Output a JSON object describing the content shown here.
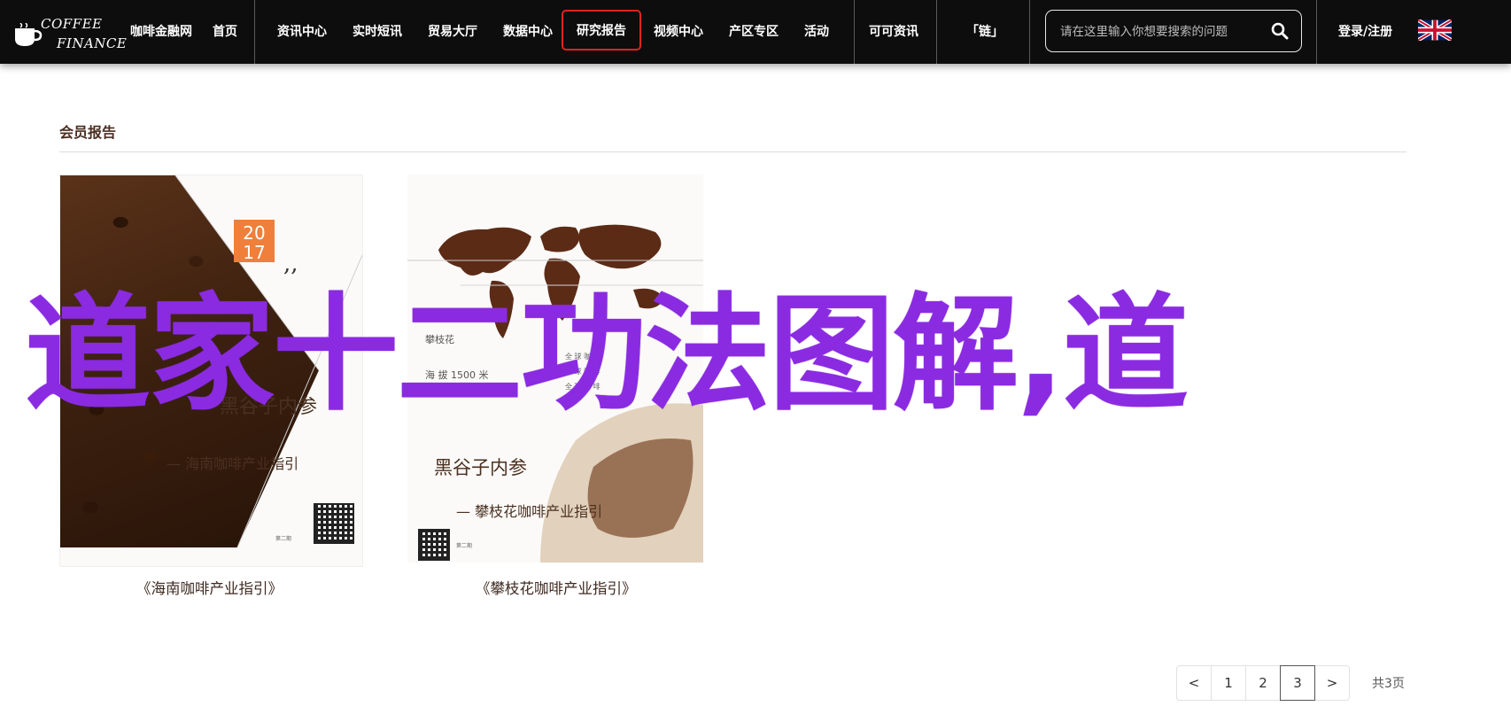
{
  "nav": {
    "logo": {
      "line1": "COFFEE",
      "line2": "FINANCE"
    },
    "items": [
      {
        "label": "咖啡金融网"
      },
      {
        "label": "首页"
      },
      {
        "label": "资讯中心"
      },
      {
        "label": "实时短讯"
      },
      {
        "label": "贸易大厅"
      },
      {
        "label": "数据中心"
      },
      {
        "label": "研究报告",
        "active": true
      },
      {
        "label": "视频中心"
      },
      {
        "label": "产区专区"
      },
      {
        "label": "活动"
      },
      {
        "label": "可可资讯"
      },
      {
        "label": "「链」"
      }
    ],
    "search_placeholder": "请在这里输入你想要搜索的问题",
    "login": "登录/注册",
    "active_border_color": "#e0231e"
  },
  "section": {
    "title": "会员报告"
  },
  "cards": [
    {
      "caption": "《海南咖啡产业指引》",
      "cover": {
        "year_top": "20",
        "year_bottom": "17",
        "title": "黑谷子内参",
        "subtitle": "— 海南咖啡产业指引",
        "qr_note": "第二期\n2017年10月"
      }
    },
    {
      "caption": "《攀枝花咖啡产业指引》",
      "cover": {
        "map_label_1": "攀枝花",
        "map_label_2": "海 拔 1500 米",
        "map_right_1": "全 球 咖 啡",
        "map_right_2": "全 球 咖 啡",
        "map_right_3": "全 球 咖 啡",
        "title": "黑谷子内参",
        "subtitle": "— 攀枝花咖啡产业指引",
        "qr_note": "第二期\n2017年10月"
      }
    }
  ],
  "overlay": {
    "text": "道家十二功法图解,道",
    "color": "#8a2be2"
  },
  "pagination": {
    "prev": "<",
    "pages": [
      "1",
      "2",
      "3"
    ],
    "current": "3",
    "next": ">",
    "total": "共3页"
  }
}
